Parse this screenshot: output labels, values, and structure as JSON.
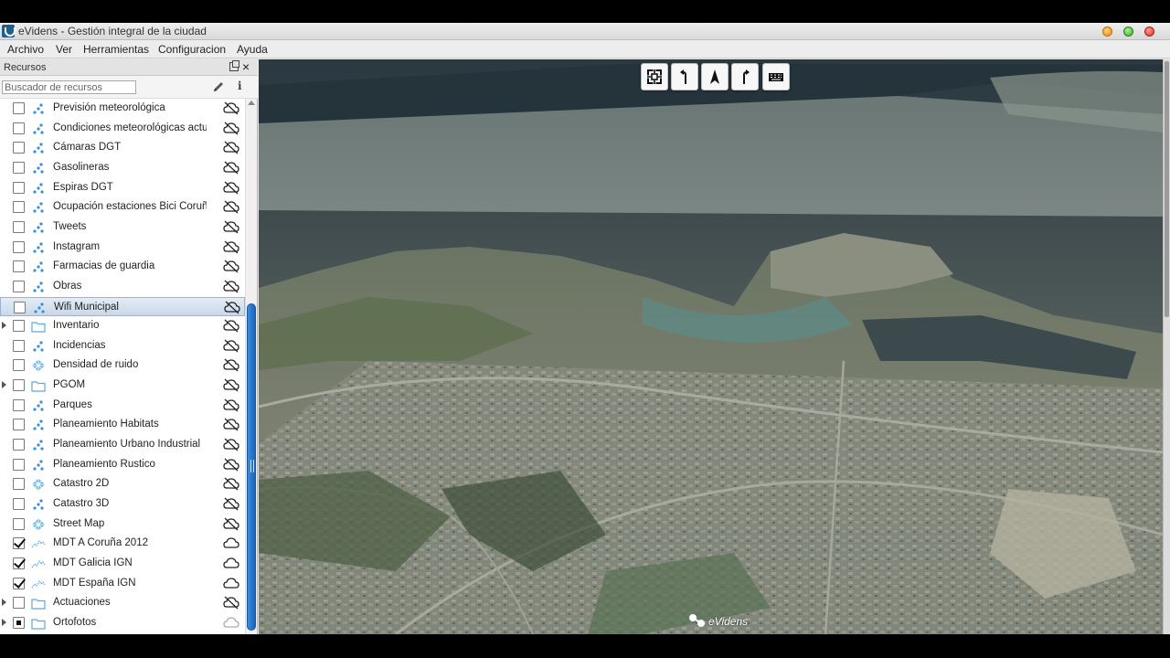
{
  "window": {
    "title": "eVidens - Gestión integral de la ciudad"
  },
  "menu": {
    "items": [
      "Archivo",
      "Ver",
      "Herramientas",
      "Configuracion",
      "Ayuda"
    ]
  },
  "panel": {
    "title": "Recursos",
    "search_placeholder": "Buscador de recursos"
  },
  "resources": [
    {
      "label": "Previsión meteorológica",
      "type": "points-icon",
      "checked": "unchecked",
      "expandable": false,
      "cloud": "cloud-off-icon"
    },
    {
      "label": "Condiciones meteorológicas actu",
      "type": "points-icon",
      "checked": "unchecked",
      "expandable": false,
      "cloud": "cloud-off-icon"
    },
    {
      "label": "Cámaras DGT",
      "type": "points-icon",
      "checked": "unchecked",
      "expandable": false,
      "cloud": "cloud-off-icon"
    },
    {
      "label": "Gasolineras",
      "type": "points-icon",
      "checked": "unchecked",
      "expandable": false,
      "cloud": "cloud-off-icon"
    },
    {
      "label": "Espiras DGT",
      "type": "points-icon",
      "checked": "unchecked",
      "expandable": false,
      "cloud": "cloud-off-icon"
    },
    {
      "label": "Ocupación estaciones Bici Coruñ",
      "type": "points-icon",
      "checked": "unchecked",
      "expandable": false,
      "cloud": "cloud-off-icon"
    },
    {
      "label": "Tweets",
      "type": "points-icon",
      "checked": "unchecked",
      "expandable": false,
      "cloud": "cloud-off-icon"
    },
    {
      "label": "Instagram",
      "type": "points-icon",
      "checked": "unchecked",
      "expandable": false,
      "cloud": "cloud-off-icon"
    },
    {
      "label": "Farmacias de guardia",
      "type": "points-icon",
      "checked": "unchecked",
      "expandable": false,
      "cloud": "cloud-off-icon"
    },
    {
      "label": "Obras",
      "type": "points-icon",
      "checked": "unchecked",
      "expandable": false,
      "cloud": "cloud-off-icon"
    },
    {
      "label": "Wifi Municipal",
      "type": "points-icon",
      "checked": "unchecked",
      "expandable": false,
      "cloud": "cloud-off-icon",
      "selected": true
    },
    {
      "label": "Inventario",
      "type": "folder-icon",
      "checked": "unchecked",
      "expandable": true,
      "cloud": "cloud-off-icon"
    },
    {
      "label": "Incidencias",
      "type": "points-icon",
      "checked": "unchecked",
      "expandable": false,
      "cloud": "cloud-off-icon"
    },
    {
      "label": "Densidad de ruido",
      "type": "raster-icon",
      "checked": "unchecked",
      "expandable": false,
      "cloud": "cloud-off-icon"
    },
    {
      "label": "PGOM",
      "type": "folder-icon",
      "checked": "unchecked",
      "expandable": true,
      "cloud": "cloud-off-icon"
    },
    {
      "label": "Parques",
      "type": "points-icon",
      "checked": "unchecked",
      "expandable": false,
      "cloud": "cloud-off-icon"
    },
    {
      "label": "Planeamiento Habitats",
      "type": "points-icon",
      "checked": "unchecked",
      "expandable": false,
      "cloud": "cloud-off-icon"
    },
    {
      "label": "Planeamiento Urbano Industrial",
      "type": "points-icon",
      "checked": "unchecked",
      "expandable": false,
      "cloud": "cloud-off-icon"
    },
    {
      "label": "Planeamiento Rustico",
      "type": "points-icon",
      "checked": "unchecked",
      "expandable": false,
      "cloud": "cloud-off-icon"
    },
    {
      "label": "Catastro 2D",
      "type": "raster-icon",
      "checked": "unchecked",
      "expandable": false,
      "cloud": "cloud-off-icon"
    },
    {
      "label": "Catastro 3D",
      "type": "points-icon",
      "checked": "unchecked",
      "expandable": false,
      "cloud": "cloud-off-icon"
    },
    {
      "label": "Street Map",
      "type": "raster-icon",
      "checked": "unchecked",
      "expandable": false,
      "cloud": "cloud-off-icon"
    },
    {
      "label": "MDT A Coruña 2012",
      "type": "terrain-icon",
      "checked": "checked",
      "expandable": false,
      "cloud": "cloud-icon"
    },
    {
      "label": "MDT Galicia IGN",
      "type": "terrain-icon",
      "checked": "checked",
      "expandable": false,
      "cloud": "cloud-icon"
    },
    {
      "label": "MDT España IGN",
      "type": "terrain-icon",
      "checked": "checked",
      "expandable": false,
      "cloud": "cloud-icon"
    },
    {
      "label": "Actuaciones",
      "type": "folder-icon",
      "checked": "unchecked",
      "expandable": true,
      "cloud": "cloud-off-icon"
    },
    {
      "label": "Ortofotos",
      "type": "folder-icon",
      "checked": "partial",
      "expandable": true,
      "cloud": "cloud-light-icon"
    }
  ],
  "map": {
    "toolbar": [
      "center-view-icon",
      "rotate-left-icon",
      "north-arrow-icon",
      "rotate-right-icon",
      "keyboard-icon"
    ],
    "logo_text": "eVidens"
  },
  "colors": {
    "accent": "#1c63b8",
    "point_icon": "#3a8fd6",
    "selected_row": "#c8d8ea"
  }
}
